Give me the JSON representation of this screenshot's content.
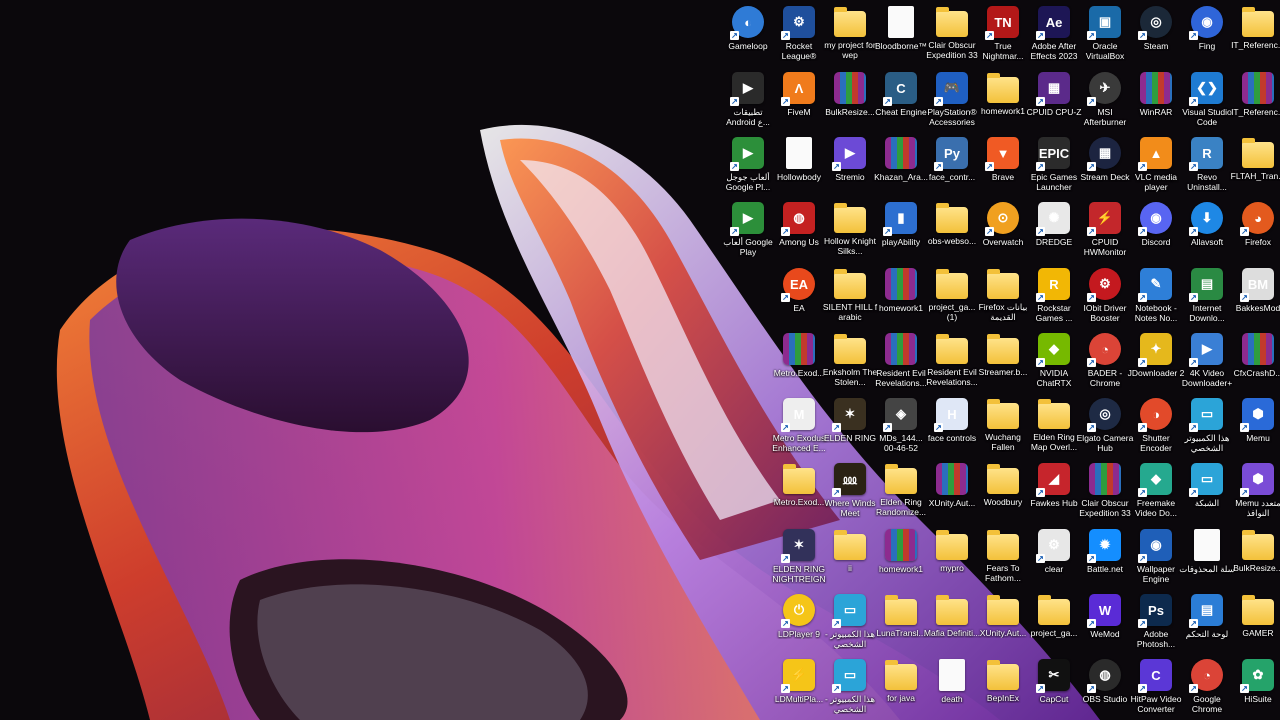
{
  "desktop": {
    "icons": [
      {
        "label": "Gameloop",
        "kind": "round",
        "color": "#2f7bd6",
        "glyph": "◐"
      },
      {
        "label": "Rocket League®",
        "kind": "app",
        "color": "#1f4f9c",
        "glyph": "⚙"
      },
      {
        "label": "my project for wep",
        "kind": "folder"
      },
      {
        "label": "Bloodborne™",
        "kind": "doc"
      },
      {
        "label": "Clair Obscur Expedition 33",
        "kind": "folder"
      },
      {
        "label": "True Nightmar...",
        "kind": "app",
        "color": "#b31818",
        "glyph": "TN"
      },
      {
        "label": "Adobe After Effects 2023",
        "kind": "app",
        "color": "#1d1655",
        "glyph": "Ae"
      },
      {
        "label": "Oracle VirtualBox",
        "kind": "app",
        "color": "#1a6aa8",
        "glyph": "▣"
      },
      {
        "label": "Steam",
        "kind": "round",
        "color": "#1b2838",
        "glyph": "◎"
      },
      {
        "label": "Fing",
        "kind": "round",
        "color": "#2f65d8",
        "glyph": "◉"
      },
      {
        "label": "IT_Referenc...",
        "kind": "folder"
      },
      {
        "label": "تطبيقات Android ع...",
        "kind": "app",
        "color": "#2a2a2a",
        "glyph": "▶"
      },
      {
        "label": "FiveM",
        "kind": "app",
        "color": "#f07b1c",
        "glyph": "Λ"
      },
      {
        "label": "BulkResize...",
        "kind": "rar"
      },
      {
        "label": "Cheat Engine",
        "kind": "app",
        "color": "#2a5d85",
        "glyph": "C"
      },
      {
        "label": "PlayStation® Accessories",
        "kind": "app",
        "color": "#1f5fc2",
        "glyph": "🎮"
      },
      {
        "label": "homework1",
        "kind": "folder"
      },
      {
        "label": "CPUID CPU-Z",
        "kind": "app",
        "color": "#5b2a8a",
        "glyph": "▦"
      },
      {
        "label": "MSI Afterburner",
        "kind": "round",
        "color": "#3a3a3a",
        "glyph": "✈"
      },
      {
        "label": "WinRAR",
        "kind": "rar"
      },
      {
        "label": "Visual Studio Code",
        "kind": "app",
        "color": "#1e7bd2",
        "glyph": "❮❯"
      },
      {
        "label": "IT_Referenc...",
        "kind": "rar"
      },
      {
        "label": "ألعاب جوجل Google Pl...",
        "kind": "app",
        "color": "#2c8f3a",
        "glyph": "▶"
      },
      {
        "label": "Hollowbody",
        "kind": "doc"
      },
      {
        "label": "Stremio",
        "kind": "app",
        "color": "#6c4ad6",
        "glyph": "▶"
      },
      {
        "label": "Khazan_Ara...",
        "kind": "rar"
      },
      {
        "label": "face_contr...",
        "kind": "app",
        "color": "#3a6fae",
        "glyph": "Py"
      },
      {
        "label": "Brave",
        "kind": "app",
        "color": "#f05a24",
        "glyph": "▼"
      },
      {
        "label": "Epic Games Launcher",
        "kind": "app",
        "color": "#2b2b2b",
        "glyph": "EPIC"
      },
      {
        "label": "Stream Deck",
        "kind": "round",
        "color": "#1c2440",
        "glyph": "▦"
      },
      {
        "label": "VLC media player",
        "kind": "app",
        "color": "#f28c1a",
        "glyph": "▲"
      },
      {
        "label": "Revo Uninstall...",
        "kind": "app",
        "color": "#3a82c4",
        "glyph": "R"
      },
      {
        "label": "FLTAH_Tran...",
        "kind": "folder"
      },
      {
        "label": "ألعاب Google Play",
        "kind": "app",
        "color": "#2c8f3a",
        "glyph": "▶"
      },
      {
        "label": "Among Us",
        "kind": "app",
        "color": "#c42121",
        "glyph": "◍"
      },
      {
        "label": "Hollow Knight Silks...",
        "kind": "folder"
      },
      {
        "label": "playAbility",
        "kind": "app",
        "color": "#2d6fd0",
        "glyph": "▮"
      },
      {
        "label": "obs-webso...",
        "kind": "folder"
      },
      {
        "label": "Overwatch",
        "kind": "round",
        "color": "#f0a020",
        "glyph": "⊙"
      },
      {
        "label": "DREDGE",
        "kind": "app",
        "color": "#e8e8e8",
        "glyph": "✺"
      },
      {
        "label": "CPUID HWMonitor",
        "kind": "app",
        "color": "#c3272b",
        "glyph": "⚡"
      },
      {
        "label": "Discord",
        "kind": "round",
        "color": "#5865f2",
        "glyph": "◉"
      },
      {
        "label": "Allavsoft",
        "kind": "round",
        "color": "#1e88e5",
        "glyph": "⬇"
      },
      {
        "label": "Firefox",
        "kind": "round",
        "color": "#e35a1e",
        "glyph": "◕"
      },
      {
        "label": "EA",
        "kind": "round",
        "color": "#e8491c",
        "glyph": "EA"
      },
      {
        "label": "SILENT HILL f arabic",
        "kind": "folder"
      },
      {
        "label": "homework1",
        "kind": "rar"
      },
      {
        "label": "project_ga... (1)",
        "kind": "folder"
      },
      {
        "label": "Firefox بيانات القديمة",
        "kind": "folder"
      },
      {
        "label": "Rockstar Games ...",
        "kind": "app",
        "color": "#f2b705",
        "glyph": "R"
      },
      {
        "label": "IObit Driver Booster",
        "kind": "round",
        "color": "#c4191f",
        "glyph": "⚙"
      },
      {
        "label": "Notebook - Notes No...",
        "kind": "app",
        "color": "#2e7fd8",
        "glyph": "✎"
      },
      {
        "label": "Internet Downlo...",
        "kind": "app",
        "color": "#2a8a43",
        "glyph": "▤"
      },
      {
        "label": "BakkesMod",
        "kind": "app",
        "color": "#dddddd",
        "glyph": "BM"
      },
      {
        "label": "Metro.Exod...",
        "kind": "rar"
      },
      {
        "label": "Enksholm The Stolen...",
        "kind": "folder"
      },
      {
        "label": "Resident Evil Revelations...",
        "kind": "rar"
      },
      {
        "label": "Resident Evil Revelations...",
        "kind": "folder"
      },
      {
        "label": "Streamer.b...",
        "kind": "folder"
      },
      {
        "label": "NVIDIA ChatRTX",
        "kind": "app",
        "color": "#76b900",
        "glyph": "◆"
      },
      {
        "label": "BADER - Chrome",
        "kind": "round",
        "color": "#db4437",
        "glyph": "◔"
      },
      {
        "label": "JDownloader 2",
        "kind": "app",
        "color": "#e5b81c",
        "glyph": "✦"
      },
      {
        "label": "4K Video Downloader+",
        "kind": "app",
        "color": "#3a7fd5",
        "glyph": "▶"
      },
      {
        "label": "CfxCrashD...",
        "kind": "rar"
      },
      {
        "label": "Metro Exodus Enhanced E...",
        "kind": "app",
        "color": "#eeeeee",
        "glyph": "M"
      },
      {
        "label": "ELDEN RING",
        "kind": "app",
        "color": "#3a3020",
        "glyph": "✶"
      },
      {
        "label": "MDs_144... 00-46-52",
        "kind": "app",
        "color": "#444444",
        "glyph": "◈"
      },
      {
        "label": "face controls",
        "kind": "app",
        "color": "#dfe7f6",
        "glyph": "H"
      },
      {
        "label": "Wuchang Fallen Feathe...",
        "kind": "folder"
      },
      {
        "label": "Elden Ring Map Overl...",
        "kind": "folder"
      },
      {
        "label": "Elgato Camera Hub",
        "kind": "round",
        "color": "#1e2a44",
        "glyph": "◎"
      },
      {
        "label": "Shutter Encoder",
        "kind": "round",
        "color": "#e24a2a",
        "glyph": "◑"
      },
      {
        "label": "هذا الكمبيوتر الشخصي",
        "kind": "app",
        "color": "#2ba4d8",
        "glyph": "▭"
      },
      {
        "label": "Memu",
        "kind": "app",
        "color": "#2a6ad8",
        "glyph": "⬢"
      },
      {
        "label": "Metro.Exod...",
        "kind": "folder"
      },
      {
        "label": "Where Winds Meet",
        "kind": "app",
        "color": "#2a2214",
        "glyph": "⅏"
      },
      {
        "label": "Elden Ring Randomize...",
        "kind": "folder"
      },
      {
        "label": "XUnity.Aut...",
        "kind": "rar"
      },
      {
        "label": "Woodbury",
        "kind": "folder"
      },
      {
        "label": "Fawkes Hub",
        "kind": "app",
        "color": "#c6252c",
        "glyph": "◢"
      },
      {
        "label": "Clair Obscur Expedition 33",
        "kind": "rar"
      },
      {
        "label": "Freemake Video Do...",
        "kind": "app",
        "color": "#25a98f",
        "glyph": "◆"
      },
      {
        "label": "الشبكة",
        "kind": "app",
        "color": "#2ba4d8",
        "glyph": "▭"
      },
      {
        "label": "Memu متعدد النوافذ",
        "kind": "app",
        "color": "#7a4cd6",
        "glyph": "⬢"
      },
      {
        "label": "ELDEN RING NIGHTREIGN",
        "kind": "app",
        "color": "#32315a",
        "glyph": "✶"
      },
      {
        "label": "ii",
        "kind": "folder"
      },
      {
        "label": "homework1",
        "kind": "rar"
      },
      {
        "label": "mypro",
        "kind": "folder"
      },
      {
        "label": "Fears To Fathom...",
        "kind": "folder"
      },
      {
        "label": "clear",
        "kind": "app",
        "color": "#e7e7e7",
        "glyph": "⚙"
      },
      {
        "label": "Battle.net",
        "kind": "app",
        "color": "#148eff",
        "glyph": "✹"
      },
      {
        "label": "Wallpaper Engine",
        "kind": "app",
        "color": "#1f5fb8",
        "glyph": "◉"
      },
      {
        "label": "سلة المحذوفات",
        "kind": "doc"
      },
      {
        "label": "BulkResize...",
        "kind": "folder"
      },
      {
        "label": "LDPlayer 9",
        "kind": "round",
        "color": "#f5c518",
        "glyph": "⏻"
      },
      {
        "label": "هذا الكمبيوتر - الشخصي",
        "kind": "app",
        "color": "#2ba4d8",
        "glyph": "▭"
      },
      {
        "label": "LunaTransl...",
        "kind": "folder"
      },
      {
        "label": "Mafia Definiti...",
        "kind": "folder"
      },
      {
        "label": "XUnity.Aut...",
        "kind": "folder"
      },
      {
        "label": "project_ga...",
        "kind": "folder"
      },
      {
        "label": "WeMod",
        "kind": "app",
        "color": "#5a2bd6",
        "glyph": "W"
      },
      {
        "label": "Adobe Photosh...",
        "kind": "app",
        "color": "#0d2a4d",
        "glyph": "Ps"
      },
      {
        "label": "لوحة التحكم",
        "kind": "app",
        "color": "#2b7dd6",
        "glyph": "▤"
      },
      {
        "label": "GAMER",
        "kind": "folder"
      },
      {
        "label": "LDMultiPla...",
        "kind": "app",
        "color": "#f5c518",
        "glyph": "⚡"
      },
      {
        "label": "هذا الكمبيوتر - الشخصي",
        "kind": "app",
        "color": "#2ba4d8",
        "glyph": "▭"
      },
      {
        "label": "for java",
        "kind": "folder"
      },
      {
        "label": "death",
        "kind": "doc"
      },
      {
        "label": "BepInEx",
        "kind": "folder"
      },
      {
        "label": "CapCut",
        "kind": "app",
        "color": "#111111",
        "glyph": "✂"
      },
      {
        "label": "OBS Studio",
        "kind": "round",
        "color": "#2a2a2a",
        "glyph": "◍"
      },
      {
        "label": "HitPaw Video Converter",
        "kind": "app",
        "color": "#5b37d6",
        "glyph": "C"
      },
      {
        "label": "Google Chrome",
        "kind": "round",
        "color": "#db4437",
        "glyph": "◔"
      },
      {
        "label": "HiSuite",
        "kind": "app",
        "color": "#25a36a",
        "glyph": "✿"
      }
    ]
  }
}
